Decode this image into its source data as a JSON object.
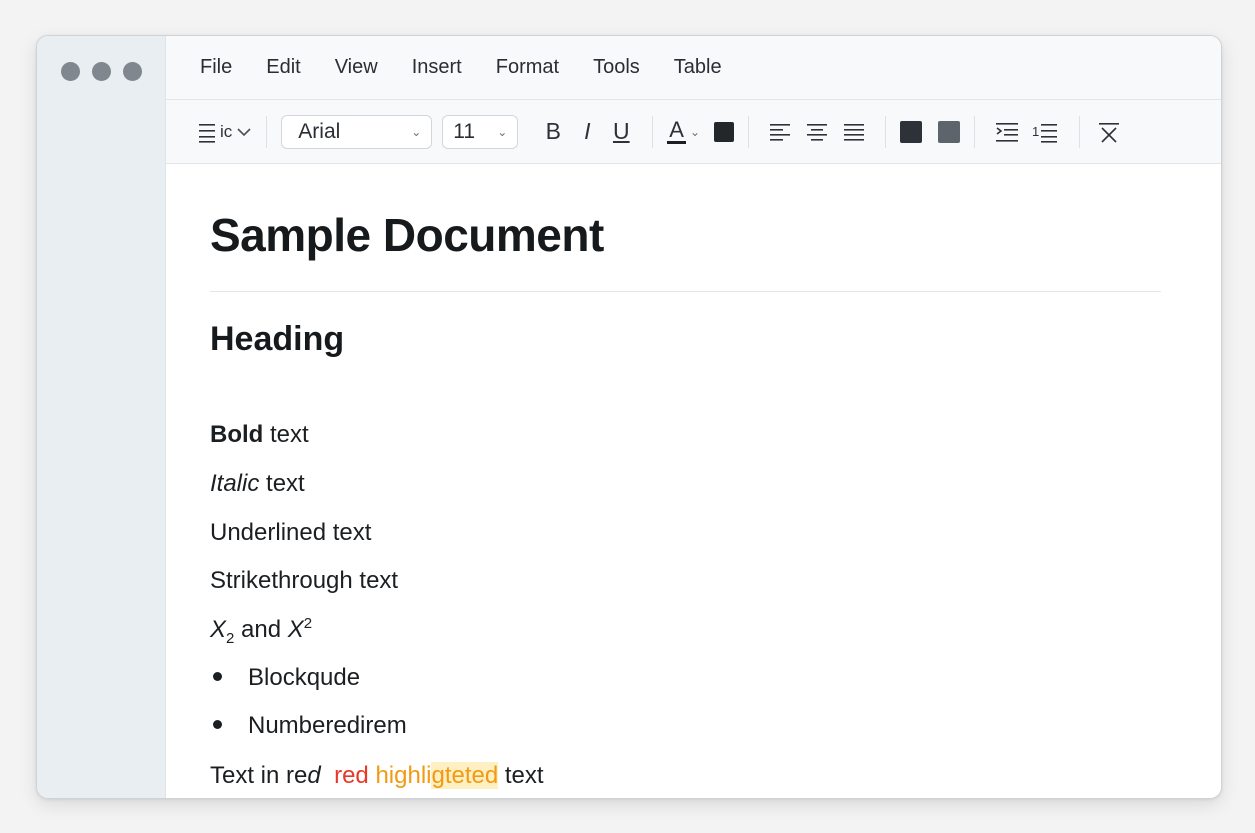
{
  "menu": [
    "File",
    "Edit",
    "View",
    "Insert",
    "Format",
    "Tools",
    "Table"
  ],
  "toolbar": {
    "style_label": "ic",
    "font": "Arial",
    "size": "11",
    "bold_label": "B",
    "italic_label": "I",
    "underline_label": "U",
    "text_color_label": "A"
  },
  "document": {
    "title": "Sample Document",
    "heading": "Heading",
    "bold_word": "Bold",
    "bold_rest": " text",
    "italic_word": "Italic",
    "italic_rest": " text",
    "underlined": "Underlined text",
    "strike": "Strikethrough text",
    "sub_base": "X",
    "sub_val": "2",
    "and_text": " and ",
    "sup_base": "X",
    "sup_val": "2",
    "bullets": [
      "Blockqude",
      "Numberedirem"
    ],
    "color_line": {
      "part1": "Text in re",
      "part2": "d",
      "part3": "red",
      "part4": "highli",
      "part5": "gteted",
      "part6": " text"
    }
  },
  "colors": {
    "accent_red": "#e8382a",
    "accent_orange": "#f29a12",
    "highlight": "#fff0c4"
  }
}
